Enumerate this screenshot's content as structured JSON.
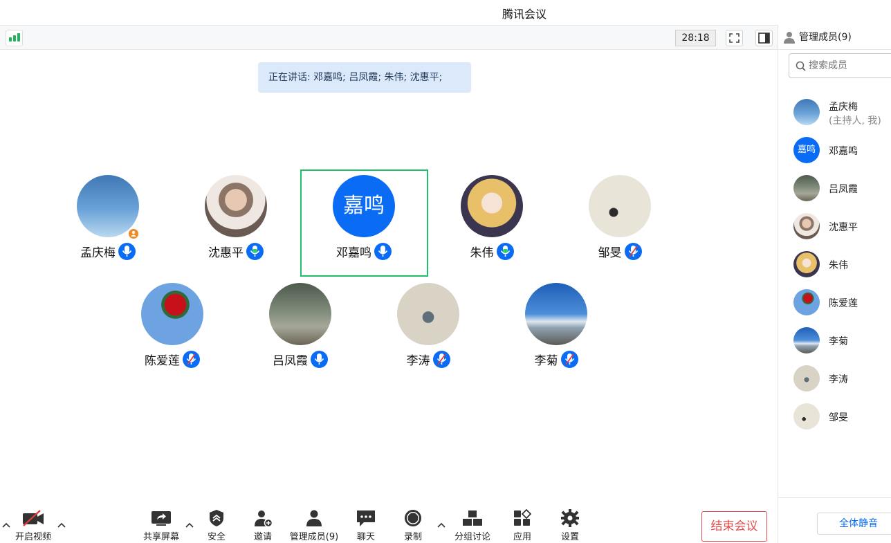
{
  "window": {
    "title": "腾讯会议"
  },
  "topbar": {
    "timer": "28:18"
  },
  "speaking_banner": "正在讲话: 邓嘉鸣; 吕凤霞; 朱伟; 沈惠平;",
  "participants": [
    {
      "name": "孟庆梅",
      "avatar": "sky",
      "mic": "on"
    },
    {
      "name": "沈惠平",
      "avatar": "man",
      "mic": "speaking"
    },
    {
      "name": "邓嘉鸣",
      "avatar_text": "嘉鸣",
      "mic": "on"
    },
    {
      "name": "朱伟",
      "avatar": "anime",
      "mic": "speaking"
    },
    {
      "name": "邹旻",
      "avatar": "swan",
      "mic": "muted"
    },
    {
      "name": "陈爱莲",
      "avatar": "rose",
      "mic": "muted"
    },
    {
      "name": "吕凤霞",
      "avatar": "water",
      "mic": "on"
    },
    {
      "name": "李涛",
      "avatar": "painting",
      "mic": "muted"
    },
    {
      "name": "李菊",
      "avatar": "beach",
      "mic": "muted"
    }
  ],
  "bottombar": {
    "video": "开启视频",
    "share": "共享屏幕",
    "security": "安全",
    "invite": "邀请",
    "members": "管理成员(9)",
    "chat": "聊天",
    "record": "录制",
    "breakout": "分组讨论",
    "apps": "应用",
    "settings": "设置",
    "end": "结束会议"
  },
  "panel": {
    "title": "管理成员(9)",
    "search_placeholder": "搜索成员",
    "members": [
      {
        "name": "孟庆梅",
        "sub": "(主持人, 我)"
      },
      {
        "name": "邓嘉鸣",
        "avatar_text": "嘉鸣"
      },
      {
        "name": "吕凤霞"
      },
      {
        "name": "沈惠平"
      },
      {
        "name": "朱伟"
      },
      {
        "name": "陈爱莲"
      },
      {
        "name": "李菊"
      },
      {
        "name": "李涛"
      },
      {
        "name": "邹旻"
      }
    ],
    "mute_all": "全体静音"
  },
  "colors": {
    "accent": "#0a6cf5",
    "active_frame": "#1fc06a",
    "end_button": "#e24b4b",
    "host_badge": "#f08a24"
  }
}
